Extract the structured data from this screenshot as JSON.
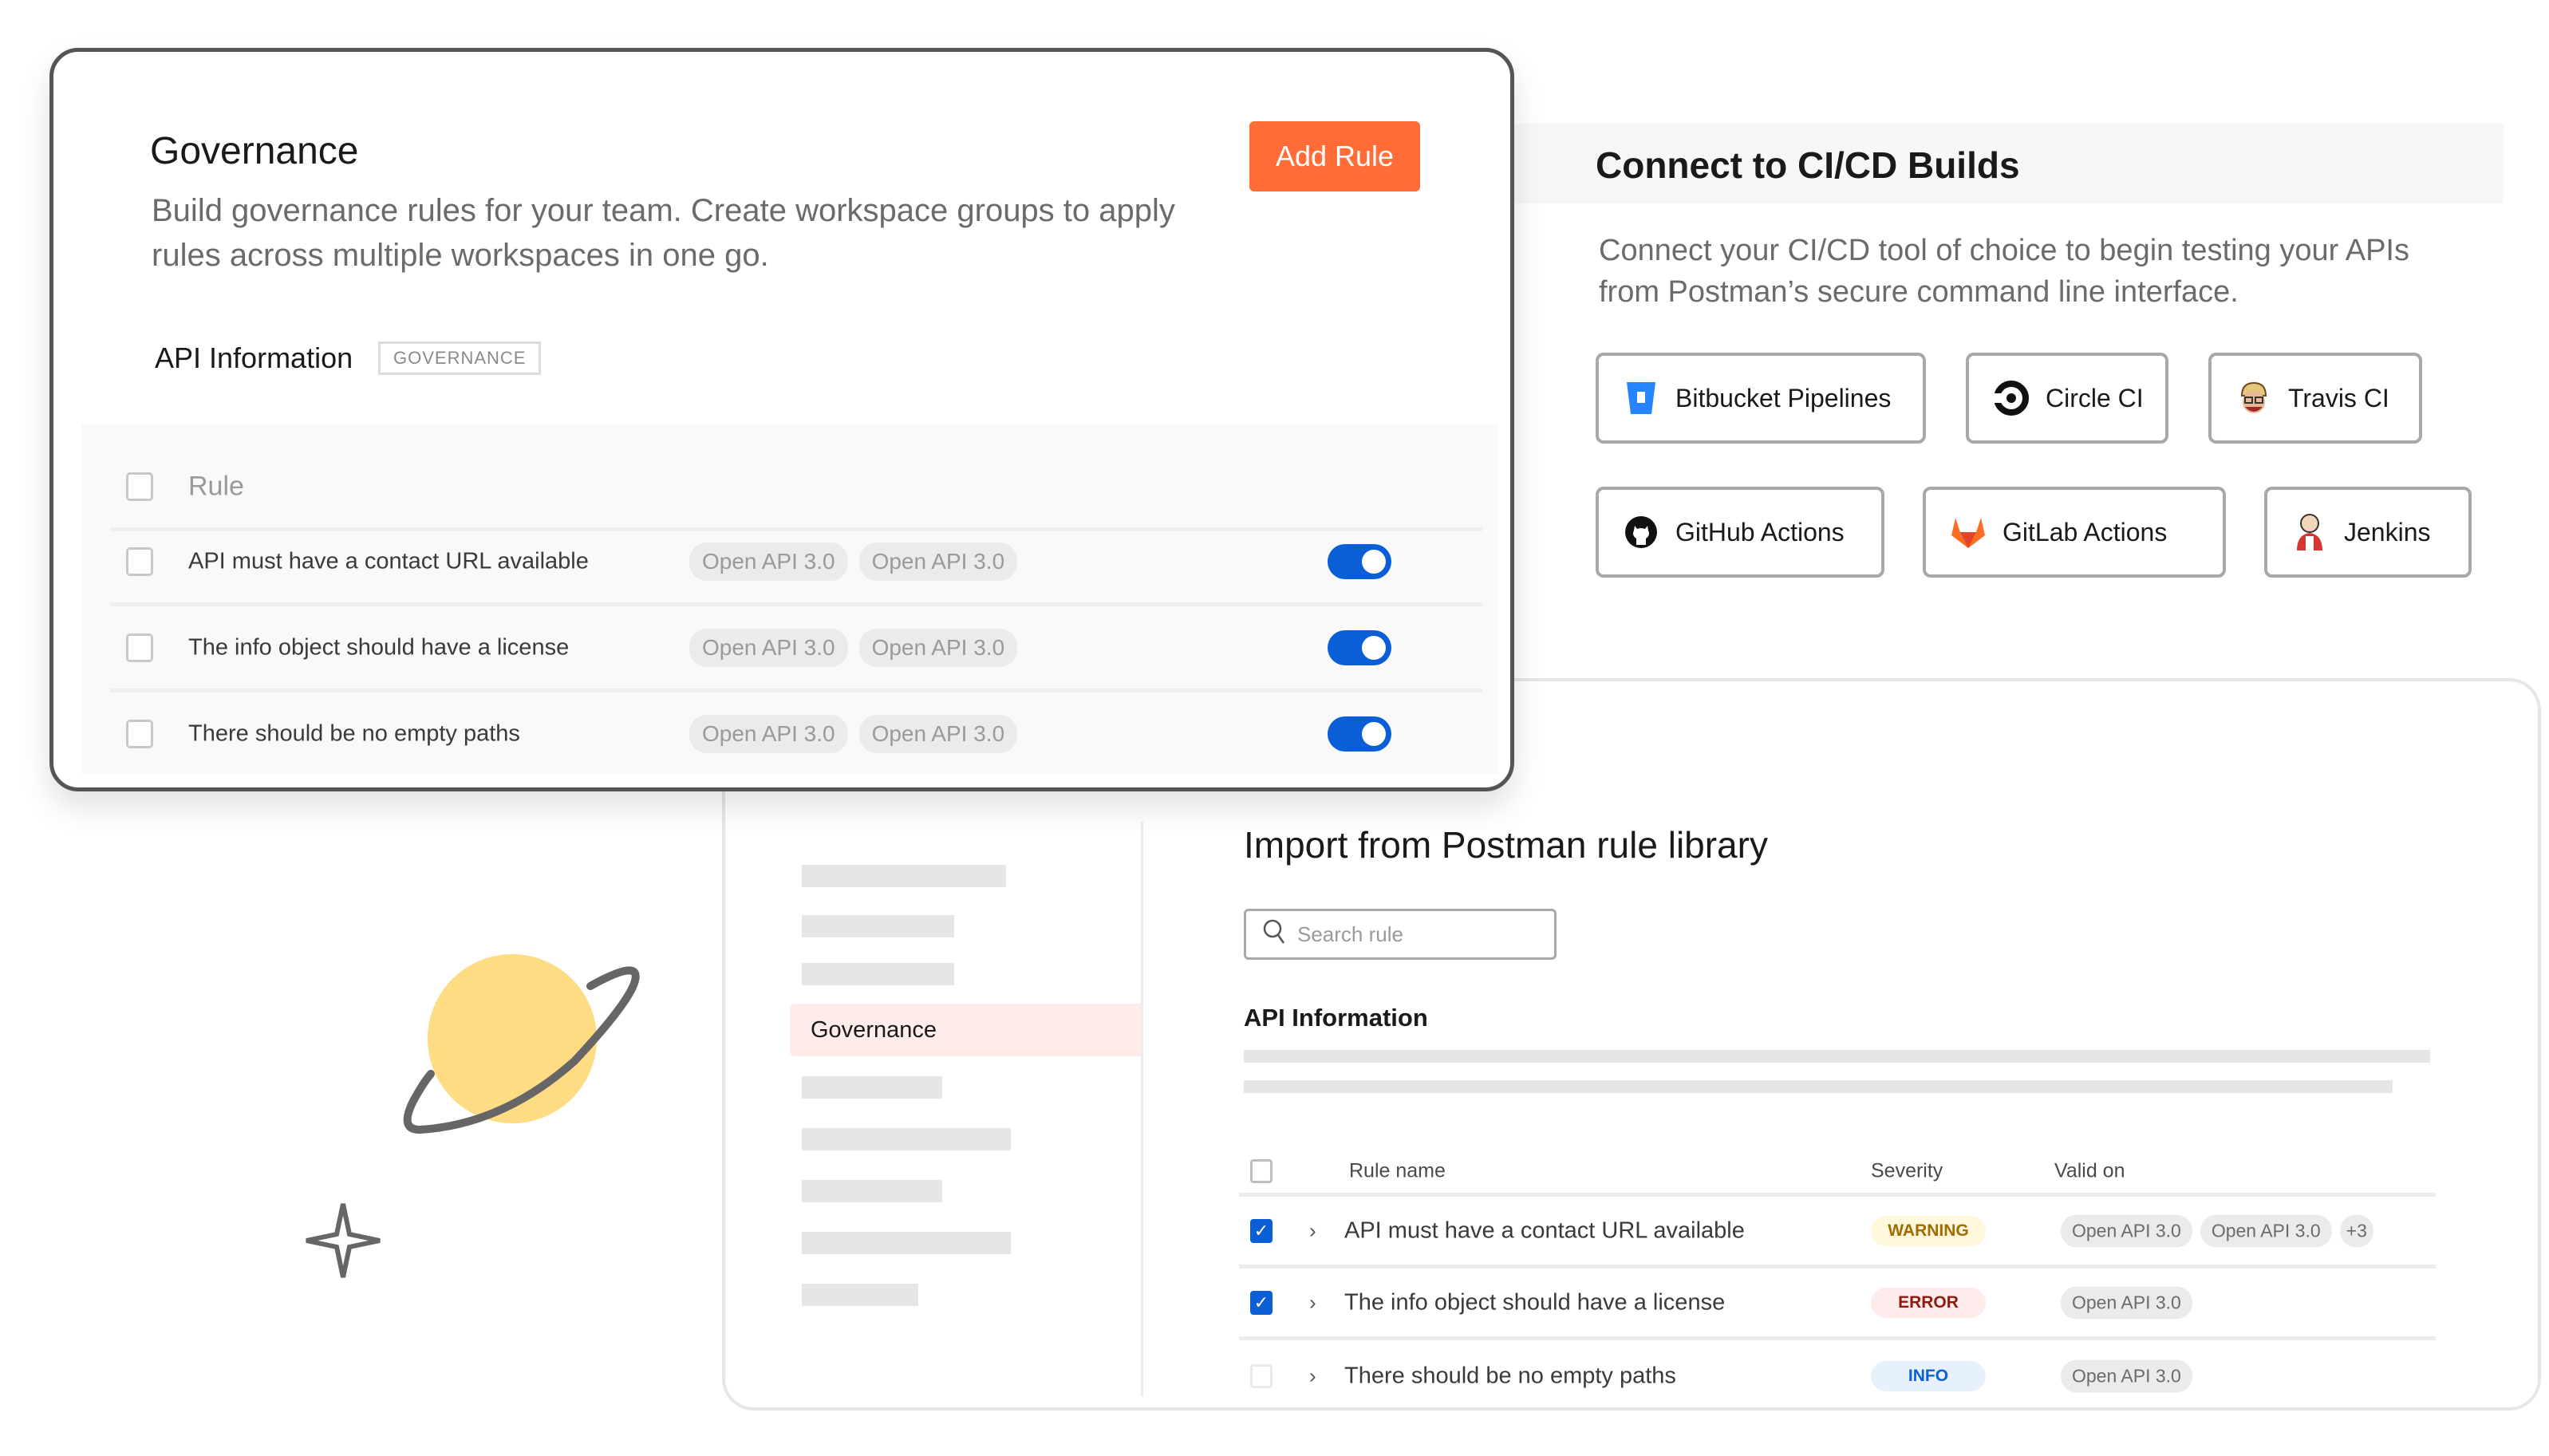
{
  "governance": {
    "title": "Governance",
    "description": "Build governance rules for your team. Create workspace groups to apply rules across multiple workspaces in one go.",
    "add_rule_label": "Add Rule",
    "section_title": "API Information",
    "section_badge": "GOVERNANCE",
    "table_header": "Rule",
    "rules": [
      {
        "name": "API must have a contact URL available",
        "tags": [
          "Open API 3.0",
          "Open API 3.0"
        ],
        "enabled": true
      },
      {
        "name": "The info object should have a license",
        "tags": [
          "Open API 3.0",
          "Open API 3.0"
        ],
        "enabled": true
      },
      {
        "name": "There should be no empty paths",
        "tags": [
          "Open API 3.0",
          "Open API 3.0"
        ],
        "enabled": true
      }
    ]
  },
  "cicd": {
    "title": "Connect to CI/CD Builds",
    "description": "Connect your CI/CD tool of choice to begin testing your APIs from Postman’s secure command line interface.",
    "tools": [
      {
        "label": "Bitbucket Pipelines",
        "icon": "bitbucket-icon"
      },
      {
        "label": "Circle CI",
        "icon": "circleci-icon"
      },
      {
        "label": "Travis CI",
        "icon": "travisci-icon"
      },
      {
        "label": "GitHub Actions",
        "icon": "github-icon"
      },
      {
        "label": "GitLab Actions",
        "icon": "gitlab-icon"
      },
      {
        "label": "Jenkins",
        "icon": "jenkins-icon"
      }
    ]
  },
  "library": {
    "sidebar_active": "Governance",
    "title": "Import from Postman rule library",
    "search_placeholder": "Search rule",
    "section_title": "API Information",
    "columns": {
      "name": "Rule name",
      "severity": "Severity",
      "valid_on": "Valid on"
    },
    "rules": [
      {
        "name": "API must have a contact URL available",
        "checked": true,
        "severity": "WARNING",
        "valid_on": [
          "Open API 3.0",
          "Open API 3.0"
        ],
        "more": "+3"
      },
      {
        "name": "The info object should have a license",
        "checked": true,
        "severity": "ERROR",
        "valid_on": [
          "Open API 3.0"
        ]
      },
      {
        "name": "There should be no empty paths",
        "checked": false,
        "severity": "INFO",
        "valid_on": [
          "Open API 3.0"
        ]
      }
    ],
    "severity_colors": {
      "WARNING": {
        "bg": "#fff8dc",
        "fg": "#a16b00"
      },
      "ERROR": {
        "bg": "#fdeceb",
        "fg": "#8e1a10"
      },
      "INFO": {
        "bg": "#e7f0fd",
        "fg": "#0b5fd6"
      }
    }
  },
  "colors": {
    "brand_orange": "#ff6c37",
    "toggle_blue": "#0b5fd6",
    "planet_yellow": "#fddc84"
  }
}
